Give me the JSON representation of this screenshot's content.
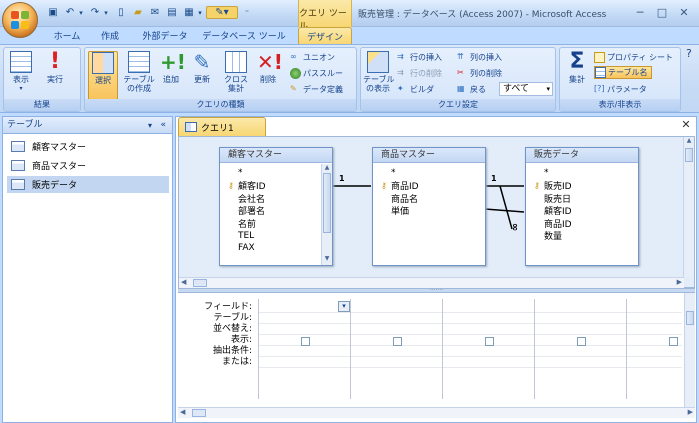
{
  "window": {
    "title": "販売管理 : データベース (Access 2007) - Microsoft Access",
    "context_tab": "クエリ ツール",
    "controls": [
      "─",
      "□",
      "✕"
    ]
  },
  "tabs": [
    {
      "label": "ホーム"
    },
    {
      "label": "作成"
    },
    {
      "label": "外部データ"
    },
    {
      "label": "データベース ツール"
    },
    {
      "label": "デザイン"
    }
  ],
  "ribbon": {
    "groups": [
      {
        "label": "結果",
        "buttons": [
          "表示",
          "実行"
        ]
      },
      {
        "label": "クエリの種類",
        "buttons": [
          "選択",
          "テーブル\nの作成",
          "追加",
          "更新",
          "クロス\n集計",
          "削除"
        ],
        "small": [
          "ユニオン",
          "パススルー",
          "データ定義"
        ]
      },
      {
        "label": "クエリ設定",
        "buttons": [
          "テーブル\nの表示"
        ],
        "small": [
          "行の挿入",
          "行の削除",
          "ビルダ",
          "列の挿入",
          "列の削除",
          "戻る"
        ],
        "return_value": "すべて"
      },
      {
        "label": "表示/非表示",
        "buttons": [
          "集計"
        ],
        "small": [
          "プロパティ シート",
          "テーブル名",
          "パラメータ"
        ]
      }
    ]
  },
  "nav": {
    "header": "テーブル",
    "items": [
      "顧客マスター",
      "商品マスター",
      "販売データ"
    ],
    "selected": 2
  },
  "document": {
    "tab": "クエリ1"
  },
  "tables": [
    {
      "name": "顧客マスター",
      "fields": [
        "*",
        "顧客ID",
        "会社名",
        "部署名",
        "名前",
        "TEL",
        "FAX"
      ],
      "key": 1
    },
    {
      "name": "商品マスター",
      "fields": [
        "*",
        "商品ID",
        "商品名",
        "単価"
      ],
      "key": 1
    },
    {
      "name": "販売データ",
      "fields": [
        "*",
        "販売ID",
        "販売日",
        "顧客ID",
        "商品ID",
        "数量"
      ],
      "key": 1
    }
  ],
  "relations": {
    "one": "1",
    "many": "∞"
  },
  "grid": {
    "row_labels": [
      "フィールド:",
      "テーブル:",
      "並べ替え:",
      "表示:",
      "抽出条件:",
      "または:"
    ]
  },
  "colors": {
    "accent": "#f7d673",
    "ribbon": "#c7dbf5",
    "frame": "#bfdbff"
  }
}
